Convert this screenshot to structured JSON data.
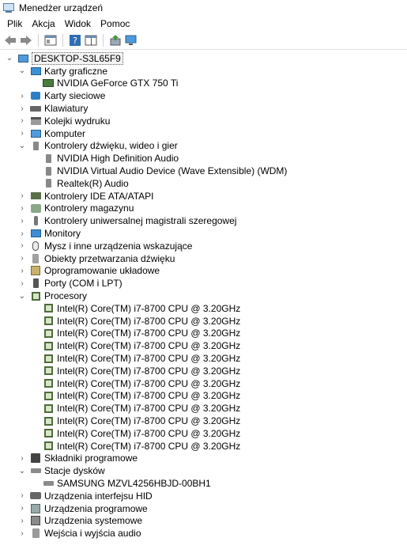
{
  "window": {
    "title": "Menedżer urządzeń"
  },
  "menu": {
    "items": [
      "Plik",
      "Akcja",
      "Widok",
      "Pomoc"
    ]
  },
  "toolbar": {
    "buttons": [
      "back-arrow-icon",
      "forward-arrow-icon",
      "properties-window-icon",
      "help-icon",
      "details-pane-icon",
      "update-driver-icon",
      "scan-hardware-icon"
    ]
  },
  "tree": {
    "root": "DESKTOP-S3L65F9",
    "categories": [
      {
        "label": "Karty graficzne",
        "expanded": true,
        "icon": "display-adapter-icon",
        "children": [
          "NVIDIA GeForce GTX 750 Ti"
        ]
      },
      {
        "label": "Karty sieciowe",
        "icon": "network-adapter-icon"
      },
      {
        "label": "Klawiatury",
        "icon": "keyboard-icon"
      },
      {
        "label": "Kolejki wydruku",
        "icon": "printer-icon"
      },
      {
        "label": "Komputer",
        "icon": "computer-icon"
      },
      {
        "label": "Kontrolery dźwięku, wideo i gier",
        "expanded": true,
        "icon": "speaker-icon",
        "children": [
          "NVIDIA High Definition Audio",
          "NVIDIA Virtual Audio Device (Wave Extensible) (WDM)",
          "Realtek(R) Audio"
        ]
      },
      {
        "label": "Kontrolery IDE ATA/ATAPI",
        "icon": "ide-controller-icon"
      },
      {
        "label": "Kontrolery magazynu",
        "icon": "storage-controller-icon"
      },
      {
        "label": "Kontrolery uniwersalnej magistrali szeregowej",
        "icon": "usb-icon"
      },
      {
        "label": "Monitory",
        "icon": "monitor-icon"
      },
      {
        "label": "Mysz i inne urządzenia wskazujące",
        "icon": "mouse-icon"
      },
      {
        "label": "Obiekty przetwarzania dźwięku",
        "icon": "audio-object-icon"
      },
      {
        "label": "Oprogramowanie układowe",
        "icon": "firmware-icon"
      },
      {
        "label": "Porty (COM i LPT)",
        "icon": "port-icon"
      },
      {
        "label": "Procesory",
        "expanded": true,
        "icon": "processor-icon",
        "children": [
          "Intel(R) Core(TM) i7-8700 CPU @ 3.20GHz",
          "Intel(R) Core(TM) i7-8700 CPU @ 3.20GHz",
          "Intel(R) Core(TM) i7-8700 CPU @ 3.20GHz",
          "Intel(R) Core(TM) i7-8700 CPU @ 3.20GHz",
          "Intel(R) Core(TM) i7-8700 CPU @ 3.20GHz",
          "Intel(R) Core(TM) i7-8700 CPU @ 3.20GHz",
          "Intel(R) Core(TM) i7-8700 CPU @ 3.20GHz",
          "Intel(R) Core(TM) i7-8700 CPU @ 3.20GHz",
          "Intel(R) Core(TM) i7-8700 CPU @ 3.20GHz",
          "Intel(R) Core(TM) i7-8700 CPU @ 3.20GHz",
          "Intel(R) Core(TM) i7-8700 CPU @ 3.20GHz",
          "Intel(R) Core(TM) i7-8700 CPU @ 3.20GHz"
        ]
      },
      {
        "label": "Składniki programowe",
        "icon": "software-component-icon"
      },
      {
        "label": "Stacje dysków",
        "expanded": true,
        "icon": "disk-drive-icon",
        "children": [
          "SAMSUNG MZVL4256HBJD-00BH1"
        ]
      },
      {
        "label": "Urządzenia interfejsu HID",
        "icon": "hid-icon"
      },
      {
        "label": "Urządzenia programowe",
        "icon": "software-device-icon"
      },
      {
        "label": "Urządzenia systemowe",
        "icon": "system-device-icon"
      },
      {
        "label": "Wejścia i wyjścia audio",
        "icon": "audio-io-icon"
      }
    ]
  }
}
